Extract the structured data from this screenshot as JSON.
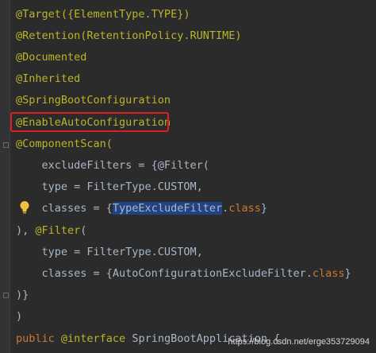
{
  "code": {
    "line1": "@Target({ElementType.TYPE})",
    "line2": "@Retention(RetentionPolicy.RUNTIME)",
    "line3": "@Documented",
    "line4": "@Inherited",
    "line5": "@SpringBootConfiguration",
    "line6": "@EnableAutoConfiguration",
    "line7": "@ComponentScan(",
    "line8": "    excludeFilters = {@Filter(",
    "line9": "    type = FilterType.CUSTOM,",
    "line10_pre": "    classes = {",
    "line10_hl": "TypeExcludeFilter",
    "line10_dot": ".",
    "line10_kw": "class",
    "line10_post": "}",
    "line11_pre": "), ",
    "line11_annot": "@Filter",
    "line11_post": "(",
    "line12": "    type = FilterType.CUSTOM,",
    "line13_pre": "    classes = {AutoConfigurationExcludeFilter.",
    "line13_kw": "class",
    "line13_post": "}",
    "line14": ")}",
    "line15": ")",
    "line16_kw1": "public",
    "line16_annot": " @interface",
    "line16_post": " SpringBootApplication {"
  },
  "watermark": "https://blog.csdn.net/erge353729094",
  "colors": {
    "background": "#2b2b2b",
    "annotation": "#bbb529",
    "keyword": "#cc7832",
    "text": "#a9b7c6",
    "selection": "#214283",
    "highlight_box": "#e02020"
  }
}
